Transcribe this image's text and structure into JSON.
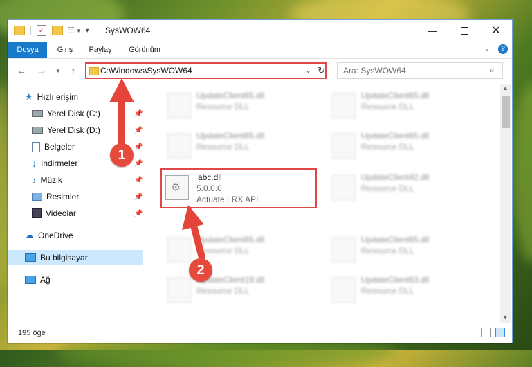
{
  "window": {
    "title": "SysWOW64"
  },
  "ribbon": {
    "tabs": [
      "Dosya",
      "Giriş",
      "Paylaş",
      "Görünüm"
    ]
  },
  "address": {
    "path": "C:\\Windows\\SysWOW64"
  },
  "search": {
    "placeholder": "Ara: SysWOW64"
  },
  "sidebar": {
    "items": [
      {
        "label": "Hızlı erişim",
        "icon": "star-icon"
      },
      {
        "label": "Yerel Disk (C:)",
        "icon": "drive-icon",
        "pinned": true
      },
      {
        "label": "Yerel Disk (D:)",
        "icon": "drive-icon",
        "pinned": true
      },
      {
        "label": "Belgeler",
        "icon": "document-icon",
        "pinned": true
      },
      {
        "label": "İndirmeler",
        "icon": "download-icon",
        "pinned": true
      },
      {
        "label": "Müzik",
        "icon": "music-icon",
        "pinned": true
      },
      {
        "label": "Resimler",
        "icon": "picture-icon",
        "pinned": true
      },
      {
        "label": "Videolar",
        "icon": "video-icon",
        "pinned": true
      },
      {
        "label": "OneDrive",
        "icon": "cloud-icon"
      },
      {
        "label": "Bu bilgisayar",
        "icon": "computer-icon",
        "selected": true
      },
      {
        "label": "Ağ",
        "icon": "network-icon"
      }
    ]
  },
  "files": {
    "left": [
      {
        "name": "UpdateClient65.dll",
        "desc": "Resource DLL"
      },
      {
        "name": "UpdateClient65.dll",
        "desc": "Resource DLL"
      },
      {
        "name": "abc.dll",
        "version": "5.0.0.0",
        "desc": "Actuate LRX API"
      },
      {
        "name": "UpdateClient65.dll",
        "desc": "Resource DLL"
      },
      {
        "name": "UpdateClient19.dll",
        "desc": "Resource DLL"
      }
    ],
    "right": [
      {
        "name": "UpdateClient65.dll",
        "desc": "Resource DLL"
      },
      {
        "name": "UpdateClient65.dll",
        "desc": "Resource DLL"
      },
      {
        "name": "UpdateClient42.dll",
        "desc": "Resource DLL"
      },
      {
        "name": "UpdateClient65.dll",
        "desc": "Resource DLL"
      },
      {
        "name": "UpdateClient63.dll",
        "desc": "Resource DLL"
      }
    ]
  },
  "status": {
    "count": "195 öğe"
  },
  "annotations": {
    "step1": "1",
    "step2": "2"
  },
  "colors": {
    "accent": "#1979ca",
    "highlight": "#e04848",
    "badge": "#e54a3d"
  }
}
